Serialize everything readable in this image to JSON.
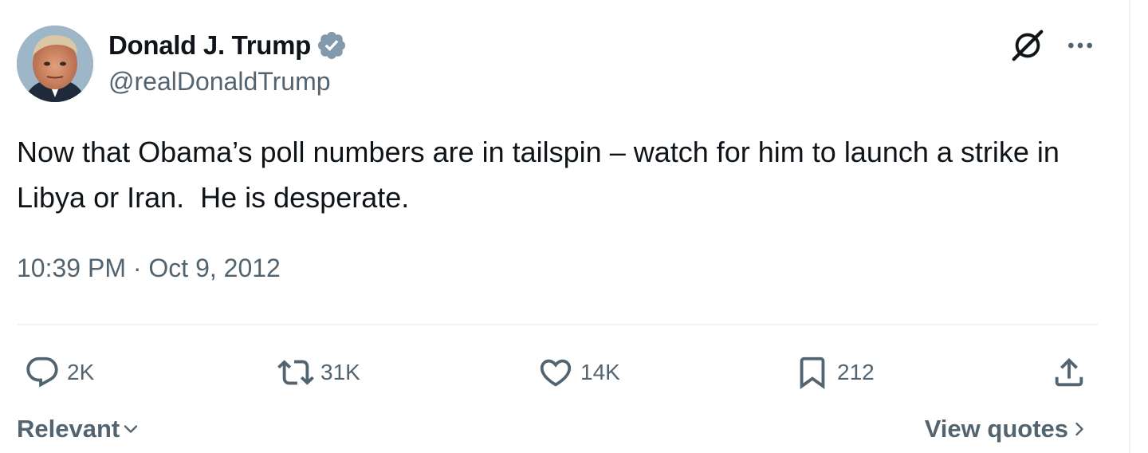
{
  "author": {
    "display_name": "Donald J. Trump",
    "handle": "@realDonaldTrump",
    "verified_icon": "verified-badge-icon",
    "verified_color": "#829aab"
  },
  "tweet": {
    "text": "Now that Obama’s poll numbers are in tailspin – watch for him to launch a strike in Libya or Iran.  He is desperate.",
    "timestamp": "10:39 PM · Oct 9, 2012"
  },
  "actions": {
    "replies": "2K",
    "reposts": "31K",
    "likes": "14K",
    "bookmarks": "212"
  },
  "footer": {
    "sort_label": "Relevant",
    "view_quotes_label": "View quotes"
  },
  "colors": {
    "text_primary": "#0f1419",
    "text_secondary": "#536471",
    "divider": "#eff3f4"
  }
}
